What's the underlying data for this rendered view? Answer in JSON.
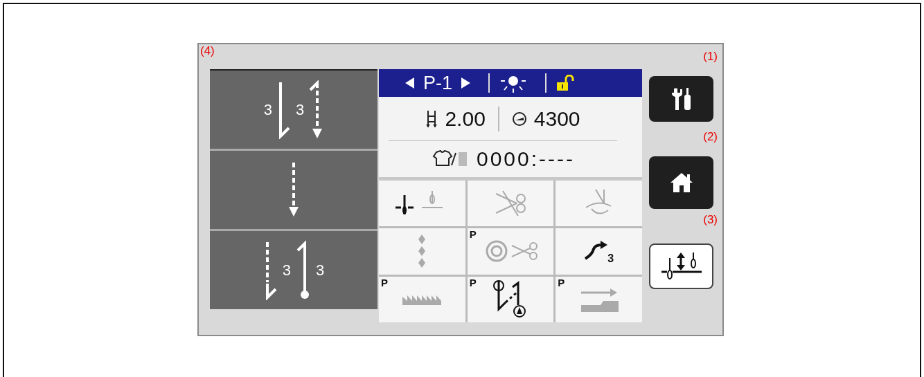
{
  "panel": {
    "callout": "(4)"
  },
  "mode_rows": [
    {
      "kind": "start-backtack",
      "labels": [
        "3",
        "3"
      ]
    },
    {
      "kind": "continuous",
      "labels": []
    },
    {
      "kind": "end-backtack",
      "labels": [
        "3",
        "3"
      ]
    }
  ],
  "header": {
    "program": "P-1"
  },
  "stitch_length": "2.00",
  "speed": "4300",
  "counter": "0000:----",
  "functions": [
    {
      "kind": "needle-position",
      "enabled": true
    },
    {
      "kind": "thread-trim",
      "enabled": false
    },
    {
      "kind": "wiper",
      "enabled": false
    },
    {
      "kind": "tack-stitch",
      "enabled": false
    },
    {
      "kind": "condensed-trim",
      "enabled": false,
      "prefix": "P"
    },
    {
      "kind": "stitch-count",
      "enabled": true,
      "count": "3"
    },
    {
      "kind": "feed",
      "enabled": false,
      "prefix": "P"
    },
    {
      "kind": "backtack-pattern",
      "enabled": true,
      "prefix": "P"
    },
    {
      "kind": "step",
      "enabled": false,
      "prefix": "P"
    }
  ],
  "side_buttons": [
    {
      "kind": "tools",
      "callout": "(1)"
    },
    {
      "kind": "home",
      "callout": "(2)"
    },
    {
      "kind": "needle-height",
      "callout": "(3)"
    }
  ]
}
